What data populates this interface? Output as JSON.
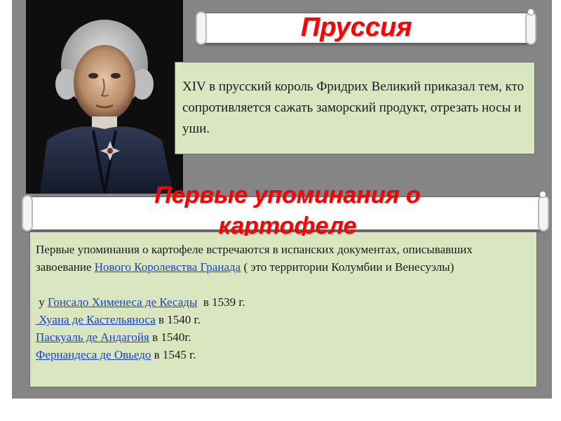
{
  "slide": {
    "title1": "Пруссия",
    "title2": "Первые упоминания о картофеле",
    "box1": {
      "text": "XIV в прусский король Фридрих Великий приказал тем, кто сопротивляется сажать заморский продукт, отрезать носы и уши."
    },
    "box2": {
      "line1_a": "Первые упоминания о картофеле  встречаются в испанских документах, описывавших завоевание ",
      "line1_link": "Нового Королевства Гранада",
      "line1_b": " ( это территории Колумбии и Венесуэлы)",
      "items": [
        {
          "prefix": " у ",
          "link": "Гонсало Хименеса де Кесады",
          "suffix": "  в 1539 г."
        },
        {
          "prefix": "",
          "link": " Хуана де Кастельяноса",
          "suffix": " в 1540 г."
        },
        {
          "prefix": "",
          "link": "Паскуаль де Андагойя",
          "suffix": " в 1540г."
        },
        {
          "prefix": "",
          "link": "Фернандеса де Овьедо",
          "suffix": " в 1545 г."
        }
      ]
    }
  },
  "colors": {
    "background": "#858585",
    "title": "#ff0000",
    "box": "#d9e6bf",
    "link": "#1a44c8"
  }
}
